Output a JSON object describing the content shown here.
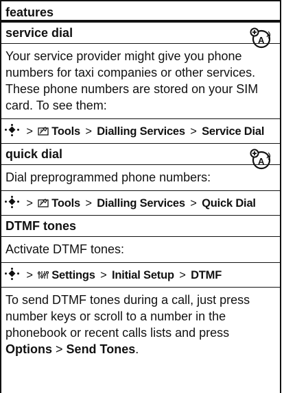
{
  "header": {
    "title": "features"
  },
  "sections": {
    "service_dial": {
      "title": "service dial",
      "description": "Your service provider might give you phone numbers for taxi companies or other services. These phone numbers are stored on your SIM card. To see them:",
      "path": {
        "gt1": ">",
        "item1": "Tools",
        "gt2": ">",
        "item2": "Dialling Services",
        "gt3": ">",
        "item3": "Service Dial"
      },
      "network_icon": "network-dependent-icon"
    },
    "quick_dial": {
      "title": "quick dial",
      "description": "Dial preprogrammed phone numbers:",
      "path": {
        "gt1": ">",
        "item1": "Tools",
        "gt2": ">",
        "item2": "Dialling Services",
        "gt3": ">",
        "item3": "Quick Dial"
      },
      "network_icon": "network-dependent-icon"
    },
    "dtmf": {
      "title": "DTMF tones",
      "description": "Activate DTMF tones:",
      "path": {
        "gt1": ">",
        "item1": "Settings",
        "gt2": ">",
        "item2": "Initial Setup",
        "gt3": ">",
        "item3": "DTMF"
      },
      "note_text": "To send DTMF tones during a call, just press number keys or scroll to a number in the phonebook or recent calls lists and press",
      "note_options": "Options",
      "note_gt": ">",
      "note_send": "Send Tones",
      "note_end": "."
    }
  }
}
